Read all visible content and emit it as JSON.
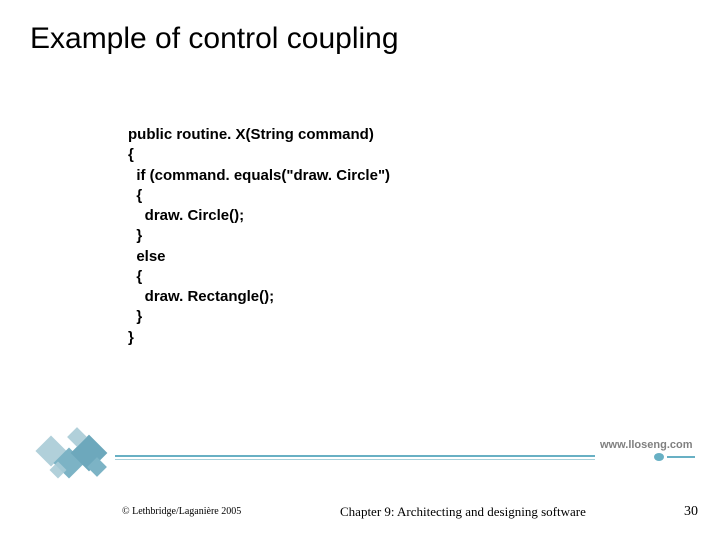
{
  "title": "Example of control coupling",
  "code": {
    "l1": "public routine. X(String command)",
    "l2": "{",
    "l3": "  if (command. equals(\"draw. Circle\")",
    "l4": "  {",
    "l5": "    draw. Circle();",
    "l6": "  }",
    "l7": "  else",
    "l8": "  {",
    "l9": "    draw. Rectangle();",
    "l10": "  }",
    "l11": "}"
  },
  "url": "www.lloseng.com",
  "copyright": "© Lethbridge/Laganière 2005",
  "chapter": "Chapter 9: Architecting and designing software",
  "page": "30"
}
